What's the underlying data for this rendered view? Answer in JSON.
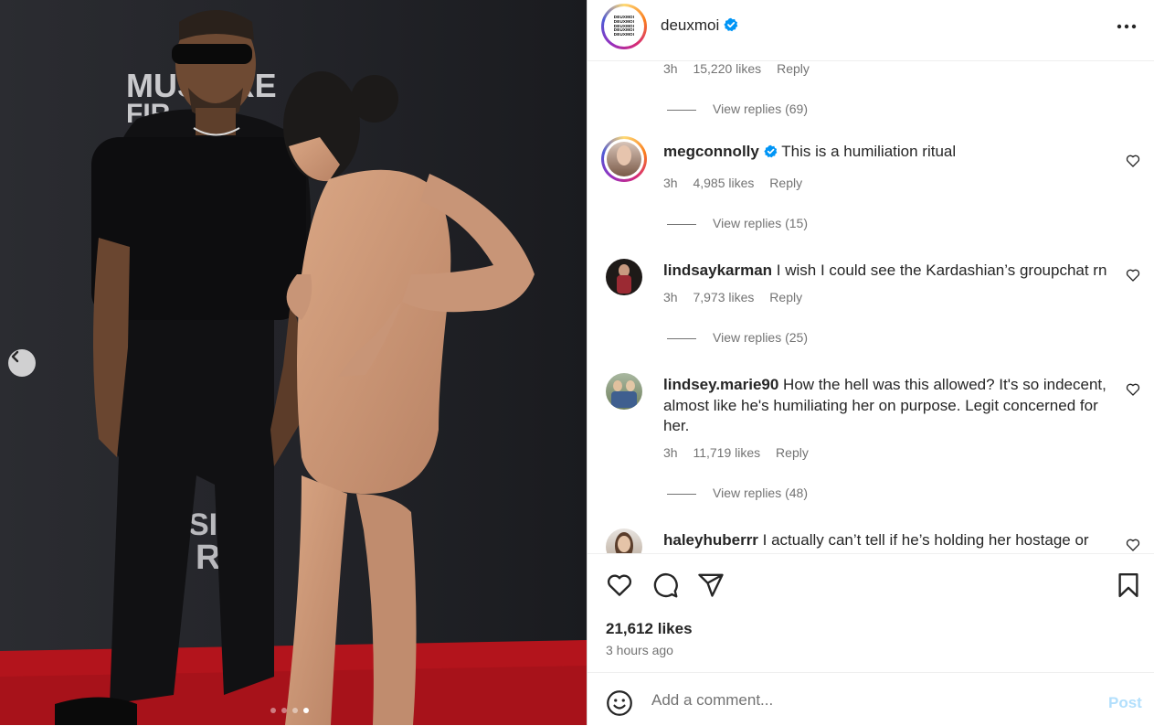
{
  "post": {
    "username": "deuxmoi",
    "avatar_text": [
      "DEUXMOI",
      "DEUXMOI",
      "DEUXMOI",
      "DEUXMOI",
      "DEUXMOI"
    ],
    "verified": true,
    "more_icon": "more-horizontal-icon",
    "likes": "21,612 likes",
    "posted": "3 hours ago",
    "backdrop_text": {
      "top_line_1": "MUS ARE",
      "top_line_2": "FIR",
      "bottom_line_1": "SICA",
      "bottom_line_2": "REL"
    },
    "carousel": {
      "count": 4,
      "active_index": 3
    }
  },
  "first_meta": {
    "time": "3h",
    "likes": "15,220 likes",
    "reply": "Reply"
  },
  "first_view_replies": "View replies (69)",
  "comments": [
    {
      "user": "megconnolly",
      "verified": true,
      "text": " This is a humiliation ritual",
      "time": "3h",
      "likes": "4,985 likes",
      "reply": "Reply",
      "view_replies": "View replies (15)"
    },
    {
      "user": "lindsaykarman",
      "verified": false,
      "text": " I wish I could see the Kardashian’s groupchat rn",
      "time": "3h",
      "likes": "7,973 likes",
      "reply": "Reply",
      "view_replies": "View replies (25)"
    },
    {
      "user": "lindsey.marie90",
      "verified": false,
      "text": " How the hell was this allowed? It's so indecent, almost like he's humiliating her on purpose. Legit concerned for her.",
      "time": "3h",
      "likes": "11,719 likes",
      "reply": "Reply",
      "view_replies": "View replies (48)"
    },
    {
      "user": "haleyhuberrr",
      "verified": false,
      "text": " I actually can’t tell if he’s holding her hostage or",
      "time": "",
      "likes": "",
      "reply": "",
      "view_replies": ""
    }
  ],
  "composer": {
    "placeholder": "Add a comment...",
    "post_label": "Post"
  },
  "colors": {
    "verified": "#0095f6",
    "muted": "#737373",
    "text": "#262626",
    "post_disabled": "#b2dffc",
    "carpet": "#b3141c"
  }
}
